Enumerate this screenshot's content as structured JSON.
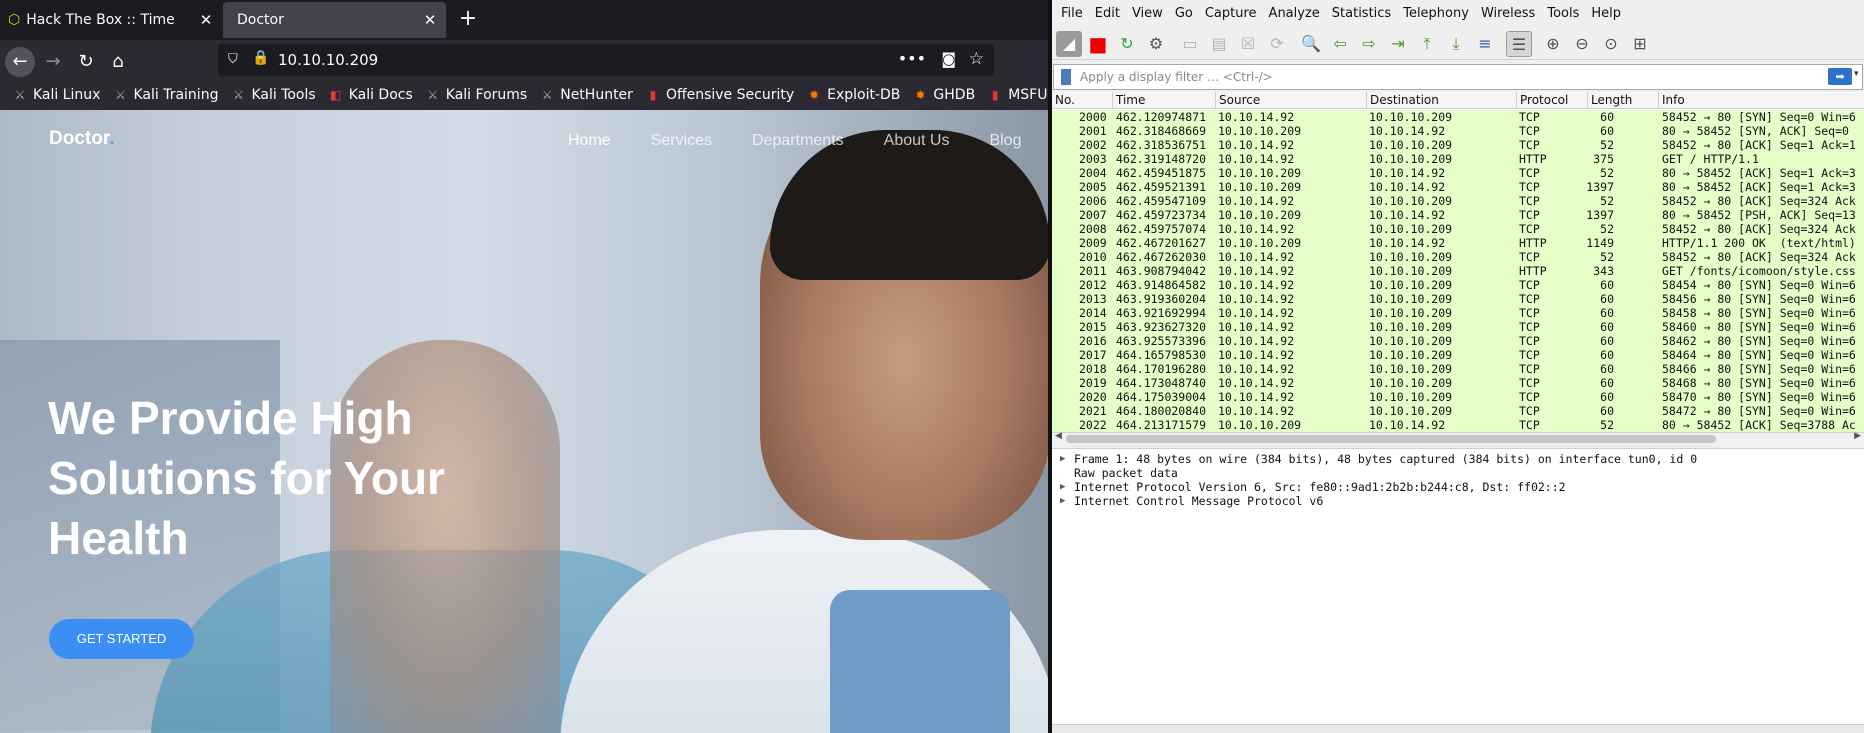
{
  "firefox": {
    "tabs": [
      {
        "title": "Hack The Box :: Time",
        "close": "✕"
      },
      {
        "title": "Doctor",
        "close": "✕"
      }
    ],
    "new_tab": "+",
    "url": "10.10.10.209",
    "bookmarks": [
      {
        "label": "Kali Linux",
        "icon": "kali-dragon-icon"
      },
      {
        "label": "Kali Training",
        "icon": "kali-dragon-icon"
      },
      {
        "label": "Kali Tools",
        "icon": "kali-dragon-icon"
      },
      {
        "label": "Kali Docs",
        "icon": "kali-docs-icon"
      },
      {
        "label": "Kali Forums",
        "icon": "kali-dragon-icon"
      },
      {
        "label": "NetHunter",
        "icon": "kali-dragon-icon"
      },
      {
        "label": "Offensive Security",
        "icon": "offsec-icon"
      },
      {
        "label": "Exploit-DB",
        "icon": "exploitdb-icon"
      },
      {
        "label": "GHDB",
        "icon": "exploitdb-icon"
      },
      {
        "label": "MSFU",
        "icon": "offsec-icon"
      }
    ]
  },
  "site": {
    "logo": "Doctor",
    "logo_dot": ".",
    "nav": [
      "Home",
      "Services",
      "Departments",
      "About Us",
      "Blog"
    ],
    "hero_lines": [
      "We Provide High",
      "Solutions for Your",
      "Health"
    ],
    "cta": "GET STARTED"
  },
  "wireshark": {
    "menu": [
      "File",
      "Edit",
      "View",
      "Go",
      "Capture",
      "Analyze",
      "Statistics",
      "Telephony",
      "Wireless",
      "Tools",
      "Help"
    ],
    "filter_placeholder": "Apply a display filter … <Ctrl-/>",
    "columns": [
      "No.",
      "Time",
      "Source",
      "Destination",
      "Protocol",
      "Length",
      "Info"
    ],
    "row_color": "#e4ffc7",
    "packets": [
      {
        "no": "2000",
        "time": "462.120974871",
        "src": "10.10.14.92",
        "dst": "10.10.10.209",
        "proto": "TCP",
        "len": "60",
        "info": "58452 → 80 [SYN] Seq=0 Win=6"
      },
      {
        "no": "2001",
        "time": "462.318468669",
        "src": "10.10.10.209",
        "dst": "10.10.14.92",
        "proto": "TCP",
        "len": "60",
        "info": "80 → 58452 [SYN, ACK] Seq=0"
      },
      {
        "no": "2002",
        "time": "462.318536751",
        "src": "10.10.14.92",
        "dst": "10.10.10.209",
        "proto": "TCP",
        "len": "52",
        "info": "58452 → 80 [ACK] Seq=1 Ack=1"
      },
      {
        "no": "2003",
        "time": "462.319148720",
        "src": "10.10.14.92",
        "dst": "10.10.10.209",
        "proto": "HTTP",
        "len": "375",
        "info": "GET / HTTP/1.1"
      },
      {
        "no": "2004",
        "time": "462.459451875",
        "src": "10.10.10.209",
        "dst": "10.10.14.92",
        "proto": "TCP",
        "len": "52",
        "info": "80 → 58452 [ACK] Seq=1 Ack=3"
      },
      {
        "no": "2005",
        "time": "462.459521391",
        "src": "10.10.10.209",
        "dst": "10.10.14.92",
        "proto": "TCP",
        "len": "1397",
        "info": "80 → 58452 [ACK] Seq=1 Ack=3"
      },
      {
        "no": "2006",
        "time": "462.459547109",
        "src": "10.10.14.92",
        "dst": "10.10.10.209",
        "proto": "TCP",
        "len": "52",
        "info": "58452 → 80 [ACK] Seq=324 Ack"
      },
      {
        "no": "2007",
        "time": "462.459723734",
        "src": "10.10.10.209",
        "dst": "10.10.14.92",
        "proto": "TCP",
        "len": "1397",
        "info": "80 → 58452 [PSH, ACK] Seq=13"
      },
      {
        "no": "2008",
        "time": "462.459757074",
        "src": "10.10.14.92",
        "dst": "10.10.10.209",
        "proto": "TCP",
        "len": "52",
        "info": "58452 → 80 [ACK] Seq=324 Ack"
      },
      {
        "no": "2009",
        "time": "462.467201627",
        "src": "10.10.10.209",
        "dst": "10.10.14.92",
        "proto": "HTTP",
        "len": "1149",
        "info": "HTTP/1.1 200 OK  (text/html)"
      },
      {
        "no": "2010",
        "time": "462.467262030",
        "src": "10.10.14.92",
        "dst": "10.10.10.209",
        "proto": "TCP",
        "len": "52",
        "info": "58452 → 80 [ACK] Seq=324 Ack"
      },
      {
        "no": "2011",
        "time": "463.908794042",
        "src": "10.10.14.92",
        "dst": "10.10.10.209",
        "proto": "HTTP",
        "len": "343",
        "info": "GET /fonts/icomoon/style.css"
      },
      {
        "no": "2012",
        "time": "463.914864582",
        "src": "10.10.14.92",
        "dst": "10.10.10.209",
        "proto": "TCP",
        "len": "60",
        "info": "58454 → 80 [SYN] Seq=0 Win=6"
      },
      {
        "no": "2013",
        "time": "463.919360204",
        "src": "10.10.14.92",
        "dst": "10.10.10.209",
        "proto": "TCP",
        "len": "60",
        "info": "58456 → 80 [SYN] Seq=0 Win=6"
      },
      {
        "no": "2014",
        "time": "463.921692994",
        "src": "10.10.14.92",
        "dst": "10.10.10.209",
        "proto": "TCP",
        "len": "60",
        "info": "58458 → 80 [SYN] Seq=0 Win=6"
      },
      {
        "no": "2015",
        "time": "463.923627320",
        "src": "10.10.14.92",
        "dst": "10.10.10.209",
        "proto": "TCP",
        "len": "60",
        "info": "58460 → 80 [SYN] Seq=0 Win=6"
      },
      {
        "no": "2016",
        "time": "463.925573396",
        "src": "10.10.14.92",
        "dst": "10.10.10.209",
        "proto": "TCP",
        "len": "60",
        "info": "58462 → 80 [SYN] Seq=0 Win=6"
      },
      {
        "no": "2017",
        "time": "464.165798530",
        "src": "10.10.14.92",
        "dst": "10.10.10.209",
        "proto": "TCP",
        "len": "60",
        "info": "58464 → 80 [SYN] Seq=0 Win=6"
      },
      {
        "no": "2018",
        "time": "464.170196280",
        "src": "10.10.14.92",
        "dst": "10.10.10.209",
        "proto": "TCP",
        "len": "60",
        "info": "58466 → 80 [SYN] Seq=0 Win=6"
      },
      {
        "no": "2019",
        "time": "464.173048740",
        "src": "10.10.14.92",
        "dst": "10.10.10.209",
        "proto": "TCP",
        "len": "60",
        "info": "58468 → 80 [SYN] Seq=0 Win=6"
      },
      {
        "no": "2020",
        "time": "464.175039004",
        "src": "10.10.14.92",
        "dst": "10.10.10.209",
        "proto": "TCP",
        "len": "60",
        "info": "58470 → 80 [SYN] Seq=0 Win=6"
      },
      {
        "no": "2021",
        "time": "464.180020840",
        "src": "10.10.14.92",
        "dst": "10.10.10.209",
        "proto": "TCP",
        "len": "60",
        "info": "58472 → 80 [SYN] Seq=0 Win=6"
      },
      {
        "no": "2022",
        "time": "464.213171579",
        "src": "10.10.10.209",
        "dst": "10.10.14.92",
        "proto": "TCP",
        "len": "52",
        "info": "80 → 58452 [ACK] Seq=3788 Ac"
      }
    ],
    "details": [
      {
        "expandable": true,
        "text": "Frame 1: 48 bytes on wire (384 bits), 48 bytes captured (384 bits) on interface tun0, id 0"
      },
      {
        "expandable": false,
        "text": "Raw packet data"
      },
      {
        "expandable": true,
        "text": "Internet Protocol Version 6, Src: fe80::9ad1:2b2b:b244:c8, Dst: ff02::2"
      },
      {
        "expandable": true,
        "text": "Internet Control Message Protocol v6"
      }
    ]
  }
}
